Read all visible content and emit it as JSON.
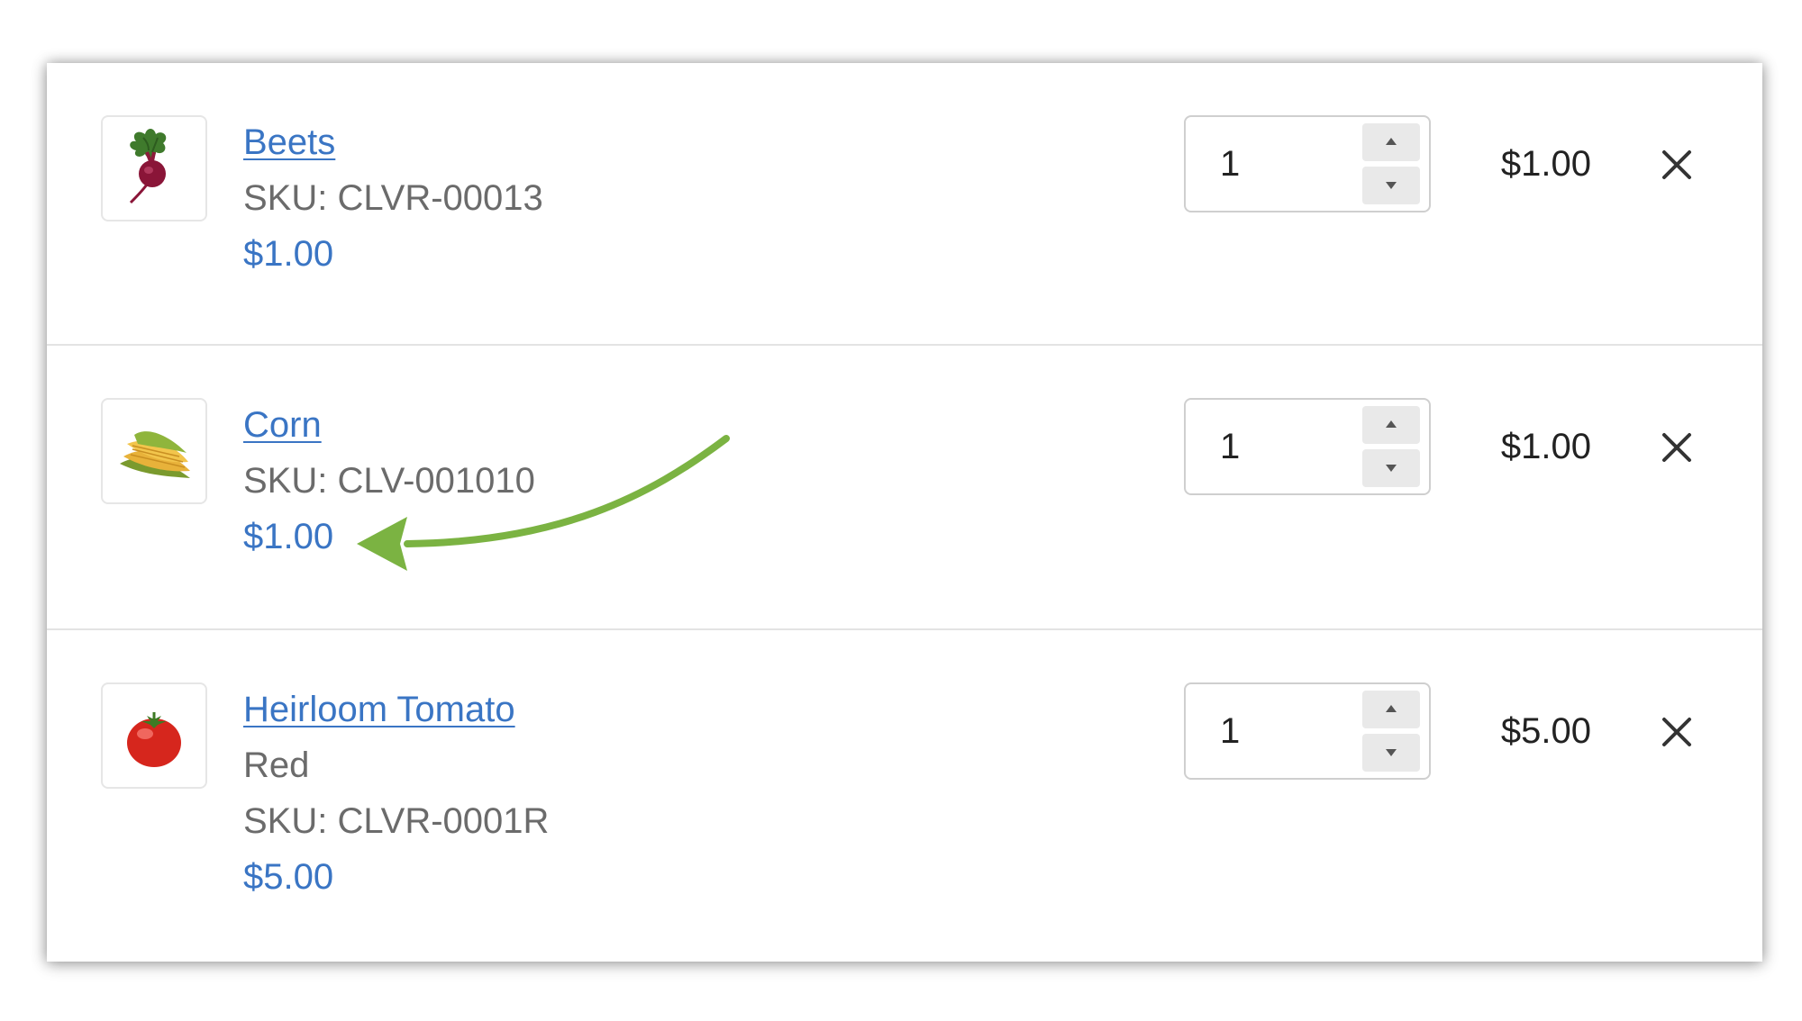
{
  "cart": {
    "items": [
      {
        "image_icon": "beet-icon",
        "name": "Beets",
        "variant": "",
        "sku": "SKU: CLVR-00013",
        "unit_price": "$1.00",
        "quantity": "1",
        "line_total": "$1.00"
      },
      {
        "image_icon": "corn-icon",
        "name": "Corn",
        "variant": "",
        "sku": "SKU: CLV-001010",
        "unit_price": "$1.00",
        "quantity": "1",
        "line_total": "$1.00"
      },
      {
        "image_icon": "tomato-icon",
        "name": "Heirloom Tomato",
        "variant": "Red",
        "sku": "SKU: CLVR-0001R",
        "unit_price": "$5.00",
        "quantity": "1",
        "line_total": "$5.00"
      }
    ]
  },
  "annotation": {
    "arrow_color": "#7bb342",
    "target": "cart.items.1.unit_price"
  },
  "colors": {
    "link": "#3a75c4",
    "secondary_text": "#6b6b6b",
    "primary_text": "#222222",
    "divider": "#e3e3e3"
  }
}
